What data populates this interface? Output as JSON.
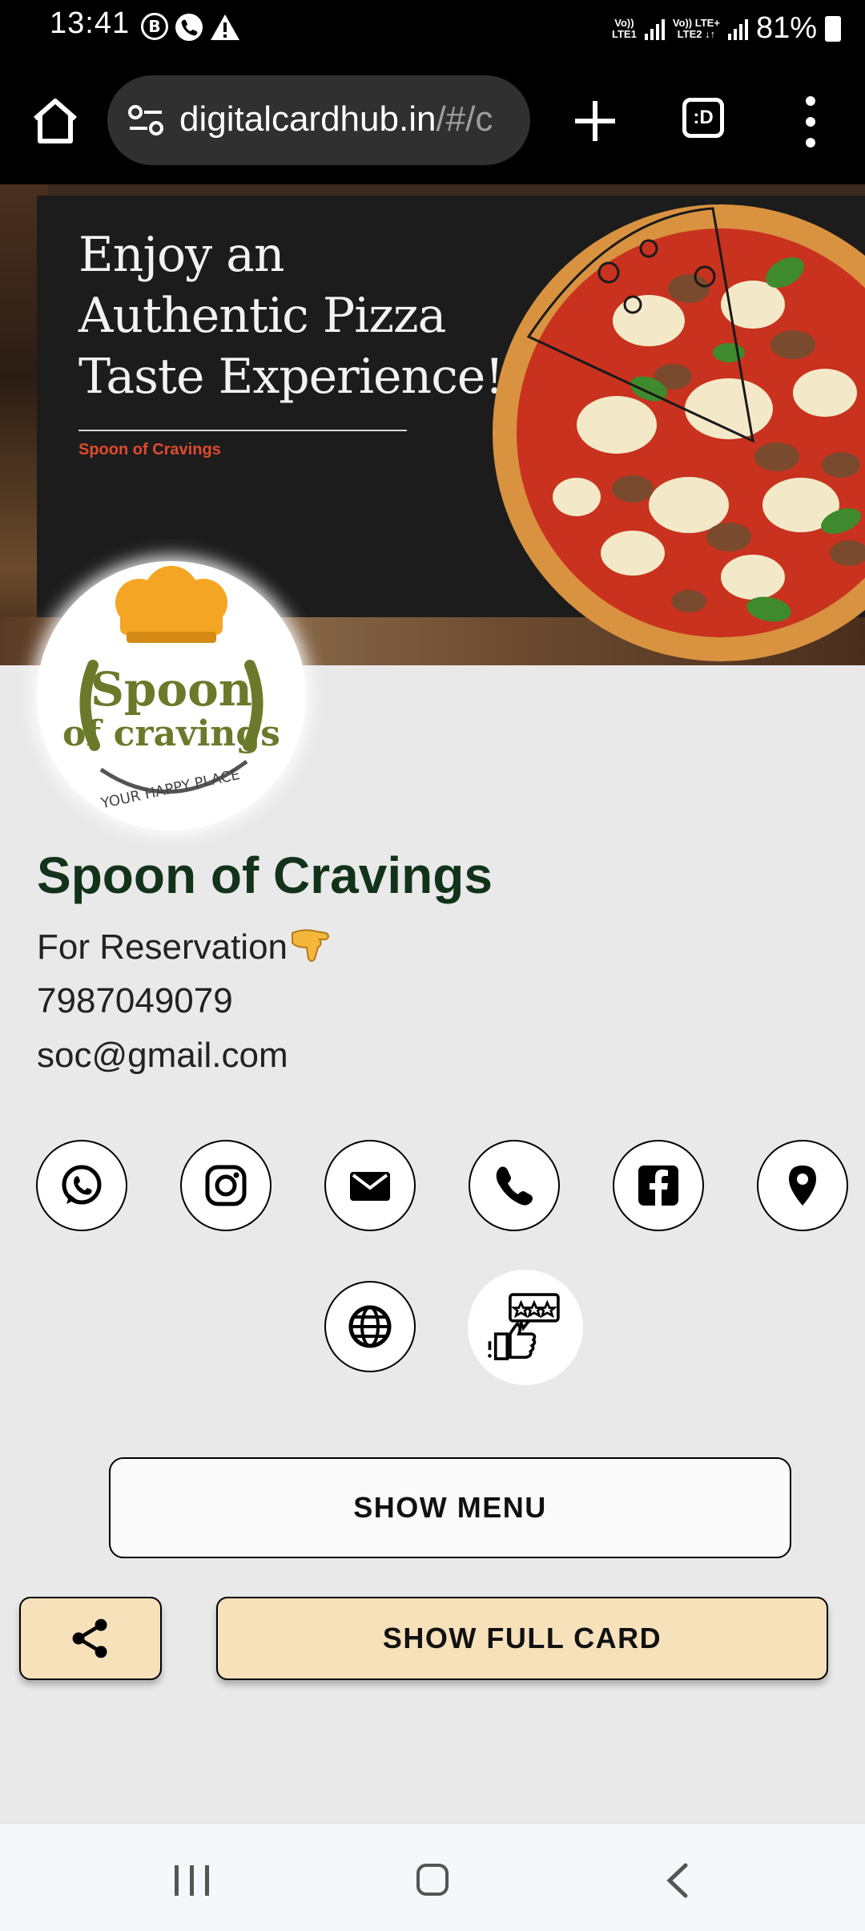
{
  "status_bar": {
    "time": "13:41",
    "left_icons": [
      "B",
      "phone-icon",
      "alert-icon"
    ],
    "sim1_label": "Vo))\nLTE1",
    "sim2_label": "Vo)) LTE+\nLTE2 ↓↑",
    "battery": "81%"
  },
  "browser": {
    "url_host": "digitalcardhub.in",
    "url_path": "/#/c",
    "tabs_label": ":D"
  },
  "banner": {
    "title_line1": "Enjoy an",
    "title_line2": "Authentic Pizza",
    "title_line3": "Taste Experience!",
    "subtitle": "Spoon of Cravings"
  },
  "logo": {
    "text_line1": "Spoon",
    "text_line2": "of cravings",
    "tagline": "YOUR HAPPY PLACE"
  },
  "profile": {
    "name": "Spoon of Cravings",
    "reservation": "For Reservation",
    "phone": "7987049079",
    "email": "soc@gmail.com"
  },
  "social_icons": [
    "whatsapp-icon",
    "instagram-icon",
    "email-icon",
    "phone-icon",
    "facebook-icon",
    "location-icon",
    "website-icon",
    "review-icon"
  ],
  "buttons": {
    "show_menu": "SHOW MENU",
    "show_full_card": "SHOW FULL CARD"
  },
  "colors": {
    "name": "#12331a",
    "button_fill": "#f6e1bb",
    "logo_green": "#6b7a2a",
    "logo_orange": "#f5a524",
    "subtitle_red": "#e04b2c"
  }
}
